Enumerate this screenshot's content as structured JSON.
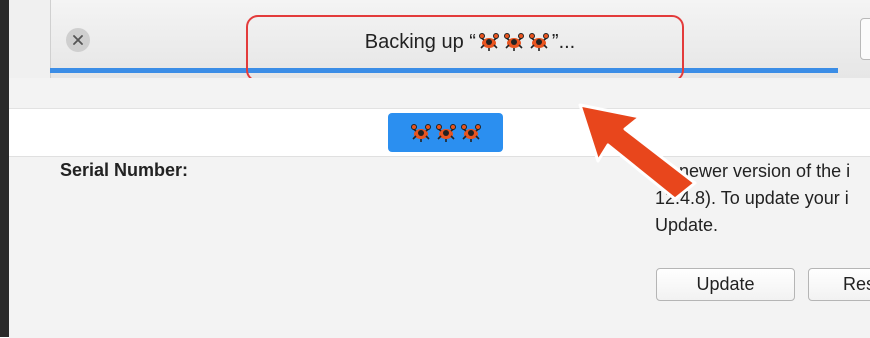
{
  "toolbar": {
    "status_prefix": "Backing up “",
    "status_suffix": "”...",
    "close_icon": "close-icon"
  },
  "device": {
    "name_icons": [
      "crab-icon",
      "crab-icon",
      "crab-icon"
    ]
  },
  "summary": {
    "serial_label": "Serial Number:",
    "update_text_line1": "newer version of the i",
    "update_text_line2": "12.4.8). To update your i",
    "update_text_line3": "Update.",
    "update_button": "Update",
    "restore_button": "Res"
  },
  "colors": {
    "accent_blue": "#2b8ff0",
    "progress_blue": "#3b8de6",
    "highlight_red": "#e33b3b",
    "arrow_orange": "#e8461c"
  }
}
